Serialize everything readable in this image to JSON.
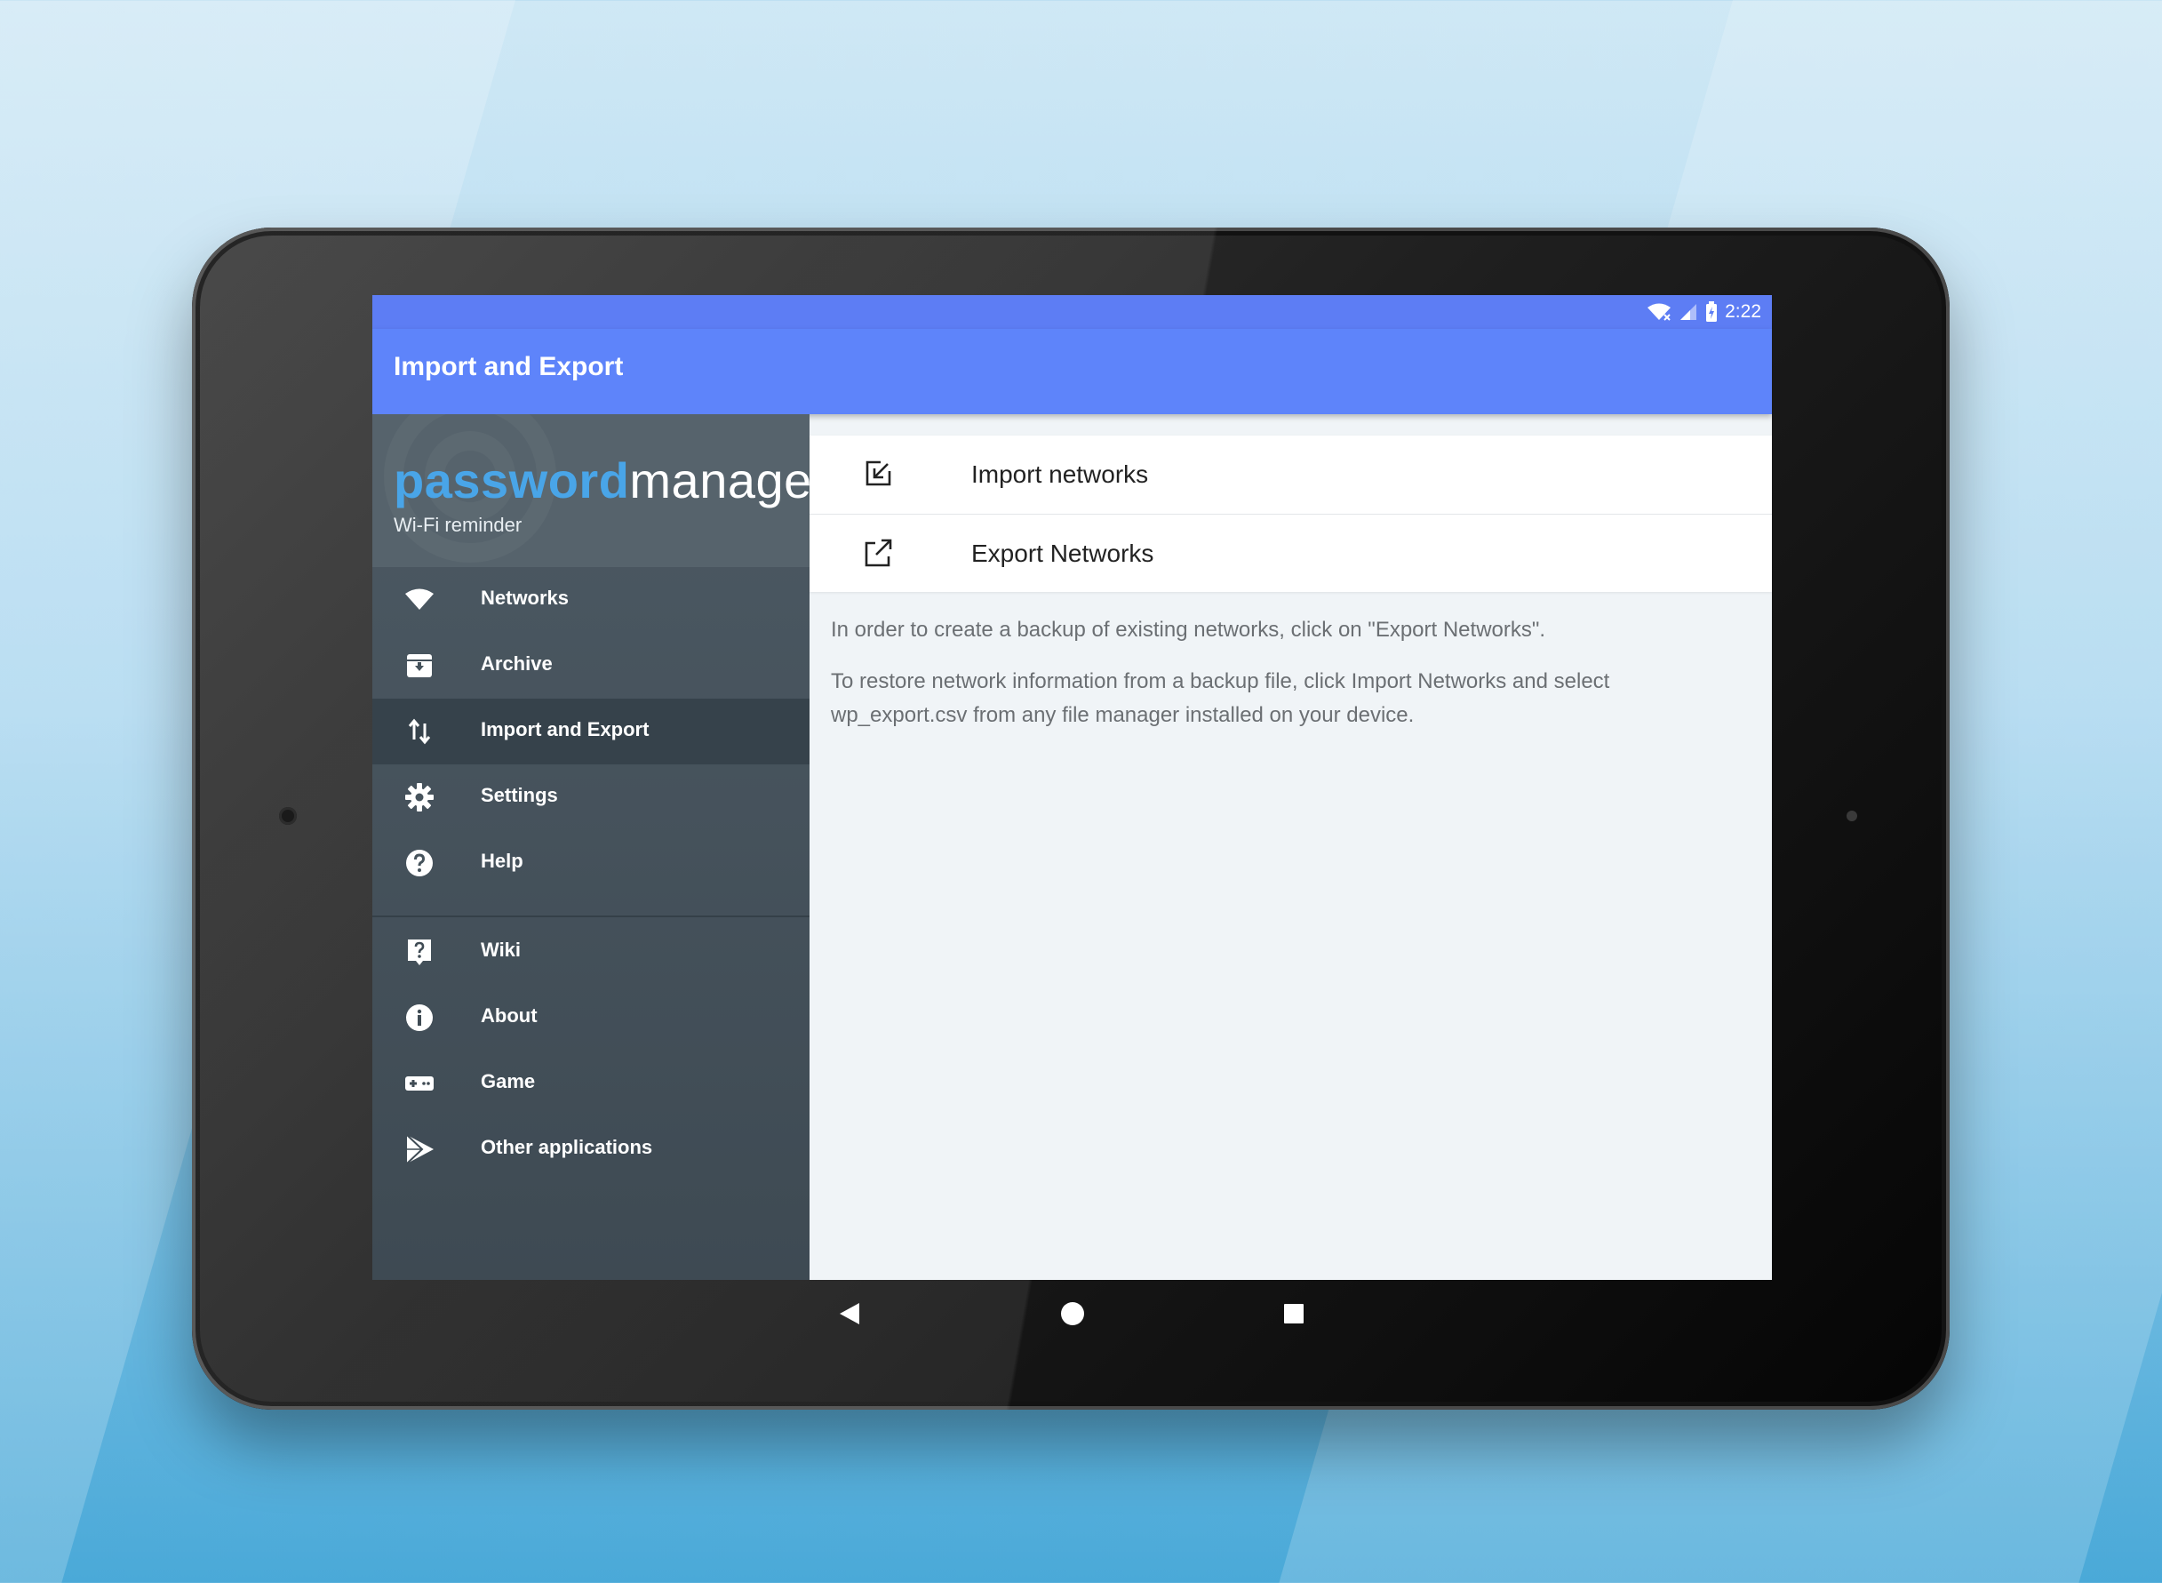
{
  "status": {
    "time": "2:22"
  },
  "toolbar": {
    "title": "Import and Export"
  },
  "drawer": {
    "brand_part1": "password",
    "brand_part2": "manager",
    "subtitle": "Wi-Fi reminder",
    "items": [
      {
        "label": "Networks",
        "icon": "wifi-icon"
      },
      {
        "label": "Archive",
        "icon": "archive-icon"
      },
      {
        "label": "Import and Export",
        "icon": "import-export-icon",
        "active": true
      },
      {
        "label": "Settings",
        "icon": "gear-icon"
      },
      {
        "label": "Help",
        "icon": "help-icon"
      }
    ],
    "secondary_items": [
      {
        "label": "Wiki",
        "icon": "wiki-icon"
      },
      {
        "label": "About",
        "icon": "info-icon"
      },
      {
        "label": "Game",
        "icon": "gamepad-icon"
      },
      {
        "label": "Other applications",
        "icon": "play-store-icon"
      }
    ]
  },
  "content": {
    "import_label": "Import networks",
    "export_label": "Export Networks",
    "info_line1": "In order to create a backup of existing networks, click on \"Export Networks\".",
    "info_line2": "To restore network information from a backup file, click Import Networks and select wp_export.csv from any file manager installed on your device."
  },
  "colors": {
    "accent": "#5e84fa",
    "drawer_bg": "#3e4a53",
    "brand_blue": "#49a5e8"
  }
}
